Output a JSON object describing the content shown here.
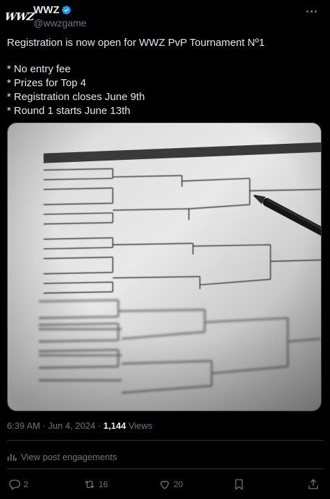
{
  "author": {
    "avatar_text": "WWZ",
    "display_name": "WWZ",
    "handle": "@wwzgame"
  },
  "tweet": {
    "headline": "Registration is now open for WWZ PvP Tournament Nº1",
    "bullets": [
      "* No entry fee",
      "* Prizes for Top 4",
      "* Registration closes June 9th",
      "* Round 1 starts June 13th"
    ]
  },
  "meta": {
    "time": "6:39 AM",
    "date": "Jun 4, 2024",
    "separator": " · ",
    "views_count": "1,144",
    "views_label": "Views"
  },
  "engagements_label": "View post engagements",
  "actions": {
    "replies": "2",
    "reposts": "16",
    "likes": "20"
  },
  "icons": [
    "verified-icon",
    "more-icon",
    "analytics-icon",
    "reply-icon",
    "repost-icon",
    "like-icon",
    "bookmark-icon",
    "share-icon"
  ],
  "colors": {
    "background": "#000000",
    "text": "#e7e9ea",
    "secondary": "#71767b",
    "verified": "#1d9bf0",
    "divider": "#2f3336"
  }
}
